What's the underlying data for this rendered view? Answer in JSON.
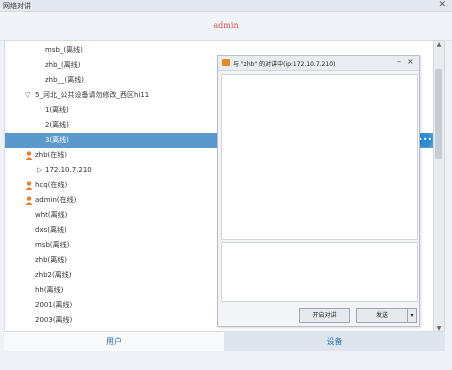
{
  "window": {
    "title": "网络对讲",
    "close": "✕"
  },
  "header": {
    "username": "admin"
  },
  "list": {
    "rows": [
      {
        "label": "msb_(离线)",
        "kind": "item"
      },
      {
        "label": "zhb_(离线)",
        "kind": "item"
      },
      {
        "label": "zhb__(离线)",
        "kind": "item"
      },
      {
        "label": "5_河北_公共设备请勿修改_西区hi11",
        "kind": "group"
      },
      {
        "label": "1(离线)",
        "kind": "sub"
      },
      {
        "label": "2(离线)",
        "kind": "sub"
      },
      {
        "label": "3(离线)",
        "kind": "sub",
        "selected": true
      },
      {
        "label": "zhb(在线)",
        "kind": "user"
      },
      {
        "label": "172.10.7.210",
        "kind": "ip"
      },
      {
        "label": "hcq(在线)",
        "kind": "user"
      },
      {
        "label": "admin(在线)",
        "kind": "user"
      },
      {
        "label": "wht(离线)",
        "kind": "item"
      },
      {
        "label": "dxs(离线)",
        "kind": "item"
      },
      {
        "label": "msb(离线)",
        "kind": "item"
      },
      {
        "label": "zhb(离线)",
        "kind": "item"
      },
      {
        "label": "zhb2(离线)",
        "kind": "item"
      },
      {
        "label": "hh(离线)",
        "kind": "item"
      },
      {
        "label": "2001(离线)",
        "kind": "item"
      },
      {
        "label": "2003(离线)",
        "kind": "item"
      }
    ]
  },
  "chat": {
    "title": "与 \"zhb\" 的对讲中(ip:172.10.7.210)",
    "minimize": "–",
    "close": "×",
    "start_button": "开启对讲",
    "send_button": "发送",
    "dropdown": "▾"
  },
  "tabs": {
    "users": "用户",
    "devices": "设备"
  },
  "icons": {
    "user": "user-icon",
    "chat": "chat-bubble-icon",
    "expand": "expand-triangle-icon"
  },
  "colors": {
    "selected_row": "#5b99cc",
    "username": "#d9534f",
    "tab_text": "#2e6ea8",
    "user_icon": "#e8822a"
  }
}
